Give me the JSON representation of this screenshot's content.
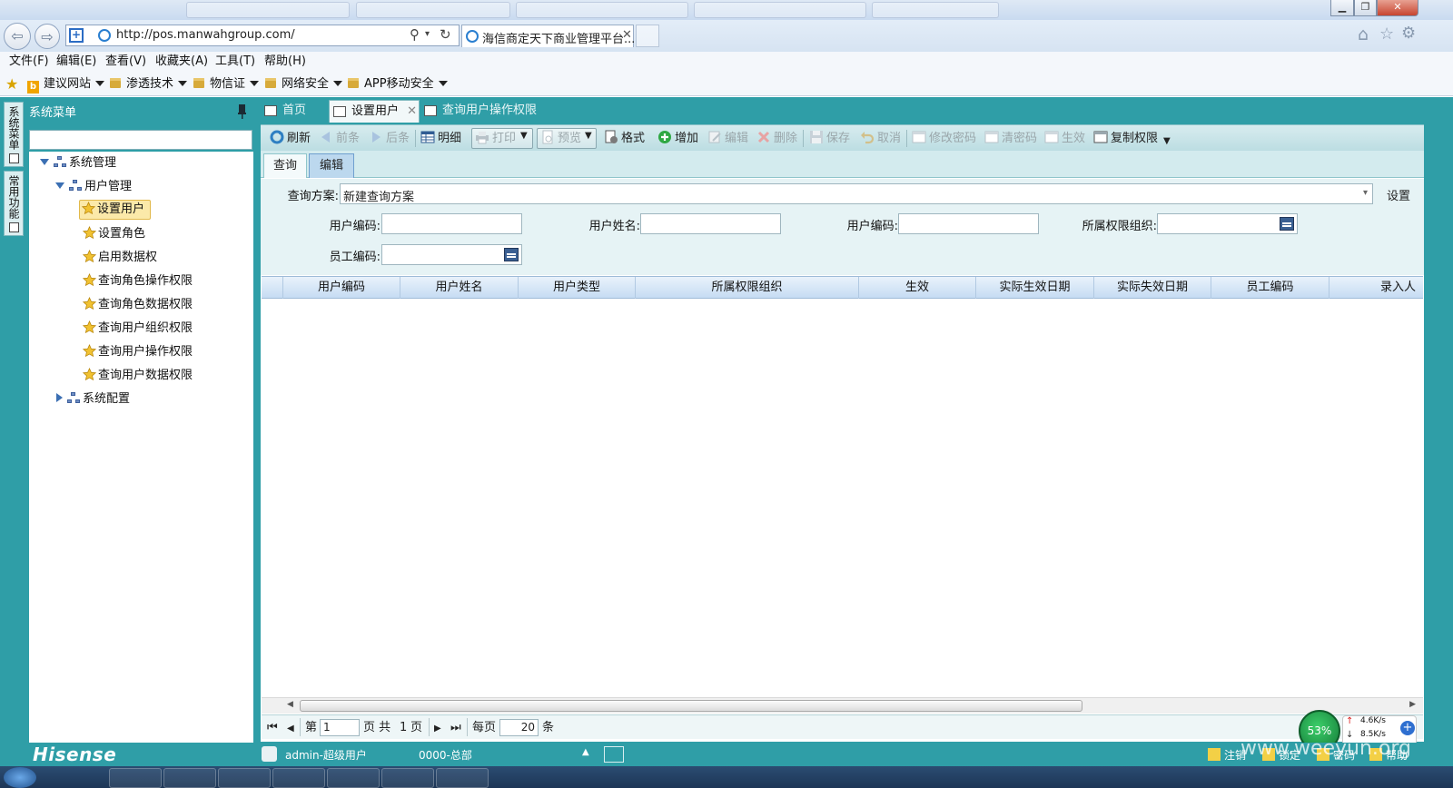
{
  "browser": {
    "url": "http://pos.manwahgroup.com/",
    "tab_title": "海信商定天下商业管理平台...",
    "menu": [
      "文件(F)",
      "编辑(E)",
      "查看(V)",
      "收藏夹(A)",
      "工具(T)",
      "帮助(H)"
    ],
    "favorites": [
      {
        "label": "建议网站",
        "has_menu": true
      },
      {
        "label": "渗透技术",
        "has_menu": true
      },
      {
        "label": "物信证",
        "has_menu": true
      },
      {
        "label": "网络安全",
        "has_menu": true
      },
      {
        "label": "APP移动安全",
        "has_menu": true
      }
    ]
  },
  "sidebar": {
    "title": "系统菜单",
    "vertical_tabs": [
      "系统菜单",
      "常用功能"
    ],
    "tree": {
      "root": "系统管理",
      "group": "用户管理",
      "items": [
        "设置用户",
        "设置角色",
        "启用数据权",
        "查询角色操作权限",
        "查询角色数据权限",
        "查询用户组织权限",
        "查询用户操作权限",
        "查询用户数据权限"
      ],
      "collapsed": "系统配置"
    }
  },
  "page_tabs": [
    "首页",
    "设置用户",
    "查询用户操作权限"
  ],
  "toolbar": {
    "refresh": "刷新",
    "prev": "前条",
    "next": "后条",
    "detail": "明细",
    "print": "打印",
    "preview": "预览",
    "format": "格式",
    "add": "增加",
    "edit": "编辑",
    "delete": "删除",
    "save": "保存",
    "cancel": "取消",
    "change_pwd": "修改密码",
    "clear_pwd": "清密码",
    "activate": "生效",
    "copy_perm": "复制权限"
  },
  "subtabs": [
    "查询",
    "编辑"
  ],
  "filter": {
    "scheme_label": "查询方案:",
    "scheme_value": "新建查询方案",
    "settings": "设置",
    "user_code_label": "用户编码:",
    "user_name_label": "用户姓名:",
    "user_code2_label": "用户编码:",
    "org_label": "所属权限组织:",
    "employee_code_label": "员工编码:"
  },
  "grid": {
    "columns": [
      "用户编码",
      "用户姓名",
      "用户类型",
      "所属权限组织",
      "生效",
      "实际生效日期",
      "实际失效日期",
      "员工编码",
      "录入人"
    ]
  },
  "pager": {
    "page_prefix": "第",
    "page_value": "1",
    "page_mid": "页 共",
    "total_pages": "1",
    "page_suffix": "页",
    "per_page_label": "每页",
    "per_page_value": "20",
    "per_page_suffix": "条"
  },
  "status": {
    "brand": "Hisense",
    "user": "admin-超级用户",
    "org": "0000-总部",
    "actions": [
      "注销",
      "锁定",
      "密码",
      "帮助"
    ]
  },
  "speed_widget": {
    "percent": "53%",
    "up": "4.6K/s",
    "down": "8.5K/s"
  },
  "watermark": "www.weeyun.org",
  "colors": {
    "app_teal": "#2f9ea7",
    "selected_node": "#fbe9a9",
    "grid_header": "#c6dcf3"
  }
}
